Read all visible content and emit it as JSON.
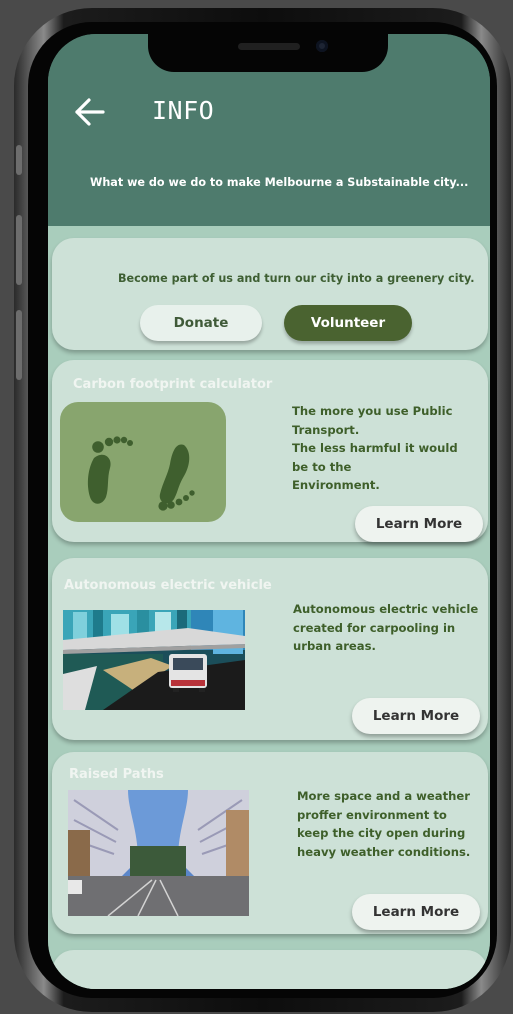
{
  "header": {
    "title": "INFO",
    "subtitle": "What we do we do to make Melbourne a Substainable city..."
  },
  "join": {
    "text": "Become part of us and turn our city into a greenery city.",
    "donate_label": "Donate",
    "volunteer_label": "Volunteer"
  },
  "cards": [
    {
      "title": "Carbon footprint calculator",
      "desc_lines": [
        "The more you use Public",
        "Transport.",
        "The less harmful it would",
        "be to the",
        "Environment."
      ],
      "button": "Learn More"
    },
    {
      "title": "Autonomous electric vehicle",
      "desc_lines": [
        "Autonomous electric vehicle",
        "created for carpooling in",
        "urban areas."
      ],
      "button": "Learn More"
    },
    {
      "title": "Raised Paths",
      "desc_lines": [
        "More space and a weather",
        "proffer environment to",
        "keep the city open during",
        "heavy weather conditions."
      ],
      "button": "Learn More"
    }
  ],
  "colors": {
    "header_bg": "#4e7b6d",
    "card_bg": "#cde1d7",
    "content_bg": "#a9cdbc",
    "accent_dark_green": "#4a6330",
    "text_green": "#3e5f2a"
  },
  "icons": {
    "back": "arrow-left-icon",
    "footprint": "footprints-icon"
  }
}
